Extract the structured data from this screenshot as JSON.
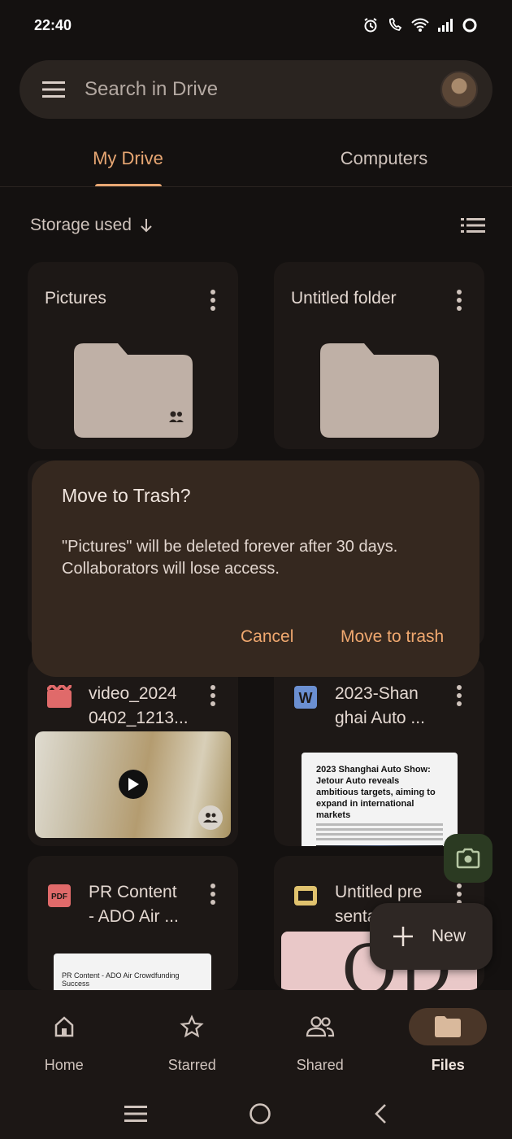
{
  "status_bar": {
    "time": "22:40"
  },
  "search": {
    "placeholder": "Search in Drive"
  },
  "tabs": [
    {
      "label": "My Drive",
      "active": true
    },
    {
      "label": "Computers",
      "active": false
    }
  ],
  "sort": {
    "label": "Storage used"
  },
  "cards": [
    {
      "title": "Pictures",
      "type": "folder",
      "shared": true
    },
    {
      "title": "Untitled folder",
      "type": "folder",
      "shared": false
    },
    {
      "title": "video_2024 0402_1213...",
      "title_line1": "video_2024",
      "title_line2": "0402_1213...",
      "type": "video",
      "shared": true
    },
    {
      "title": "2023-Shanghai Auto ...",
      "title_line1": "2023-Shan",
      "title_line2": "ghai Auto ...",
      "type": "word",
      "thumb_headline": "2023 Shanghai Auto Show: Jetour Auto reveals ambitious targets, aiming to expand in international markets"
    },
    {
      "title": "PR Content - ADO Air ...",
      "title_line1": "PR Content",
      "title_line2": "- ADO Air ...",
      "type": "pdf",
      "thumb_text": "PR Content - ADO Air Crowdfunding Success"
    },
    {
      "title": "Untitled presentation",
      "title_line1": "Untitled pre",
      "title_line2": "sentation",
      "type": "slides"
    }
  ],
  "dialog": {
    "title": "Move to Trash?",
    "body": "\"Pictures\" will be deleted forever after 30 days. Collaborators will lose access.",
    "cancel_label": "Cancel",
    "confirm_label": "Move to trash"
  },
  "fab": {
    "new_label": "New"
  },
  "bottom_nav": [
    {
      "label": "Home",
      "icon": "home-icon"
    },
    {
      "label": "Starred",
      "icon": "star-icon"
    },
    {
      "label": "Shared",
      "icon": "people-icon"
    },
    {
      "label": "Files",
      "icon": "folder-icon",
      "active": true
    }
  ],
  "colors": {
    "accent": "#e8a773",
    "dialog_bg": "#35281f",
    "background": "#141110"
  }
}
